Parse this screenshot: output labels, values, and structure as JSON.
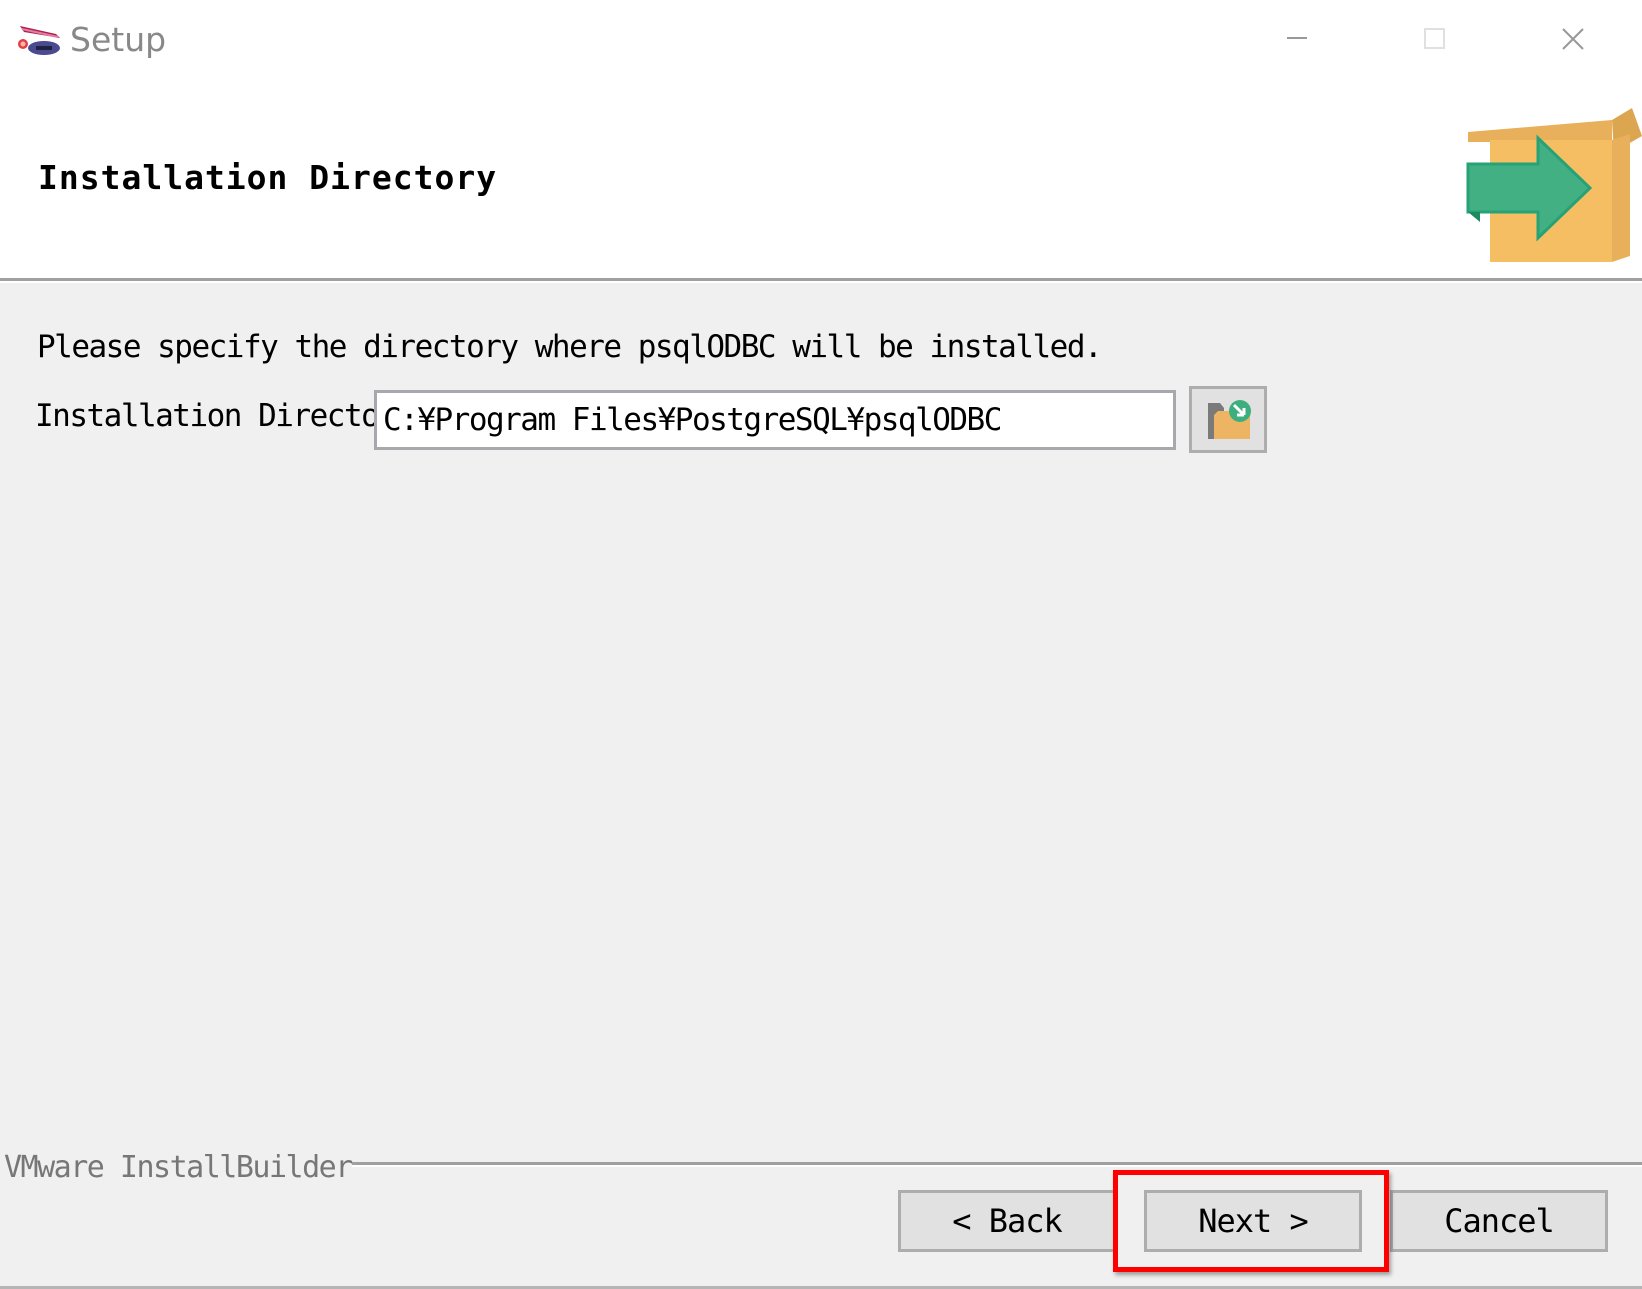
{
  "window": {
    "title": "Setup",
    "controls": {
      "minimize_icon": "minimize-icon",
      "maximize_icon": "maximize-icon",
      "close_icon": "close-icon"
    }
  },
  "header": {
    "title": "Installation Directory",
    "icon": "install-box-arrow-icon"
  },
  "body": {
    "description": "Please specify the directory where psqlODBC will be installed.",
    "directory_label": "Installation Directory",
    "directory_value": "C:¥Program Files¥PostgreSQL¥psqlODBC",
    "browse_icon": "browse-folder-icon"
  },
  "footer": {
    "brand": "VMware InstallBuilder",
    "buttons": {
      "back": "< Back",
      "next": "Next >",
      "cancel": "Cancel"
    },
    "highlighted_button": "next",
    "highlight_color": "#ff0000"
  }
}
